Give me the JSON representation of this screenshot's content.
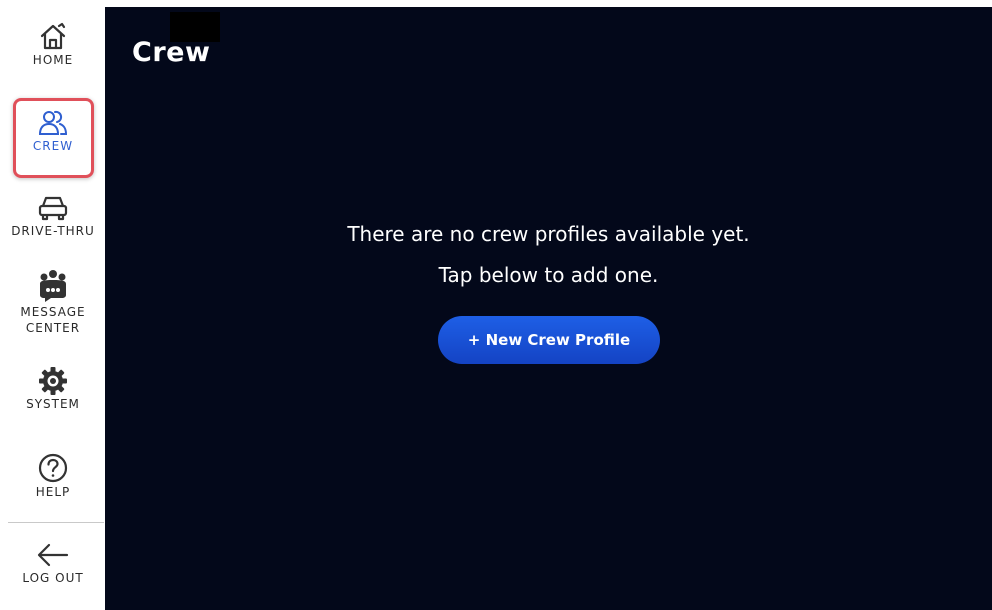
{
  "sidebar": {
    "items": [
      {
        "label": "HOME",
        "icon": "home-icon"
      },
      {
        "label": "CREW",
        "icon": "users-icon",
        "active": true
      },
      {
        "label": "DRIVE-THRU",
        "icon": "car-icon"
      },
      {
        "label": "MESSAGE\nCENTER",
        "icon": "message-center-icon"
      },
      {
        "label": "SYSTEM",
        "icon": "gear-icon"
      },
      {
        "label": "HELP",
        "icon": "help-icon"
      },
      {
        "label": "LOG OUT",
        "icon": "arrow-left-icon"
      }
    ]
  },
  "main": {
    "title": "Crew",
    "empty_line1": "There are no crew profiles available yet.",
    "empty_line2": "Tap below to add one.",
    "new_button_label": "+ New Crew Profile"
  },
  "colors": {
    "background": "#03081a",
    "accent": "#1e5fe6",
    "active_nav": "#2f5fd0",
    "highlight_border": "#e0505a"
  }
}
